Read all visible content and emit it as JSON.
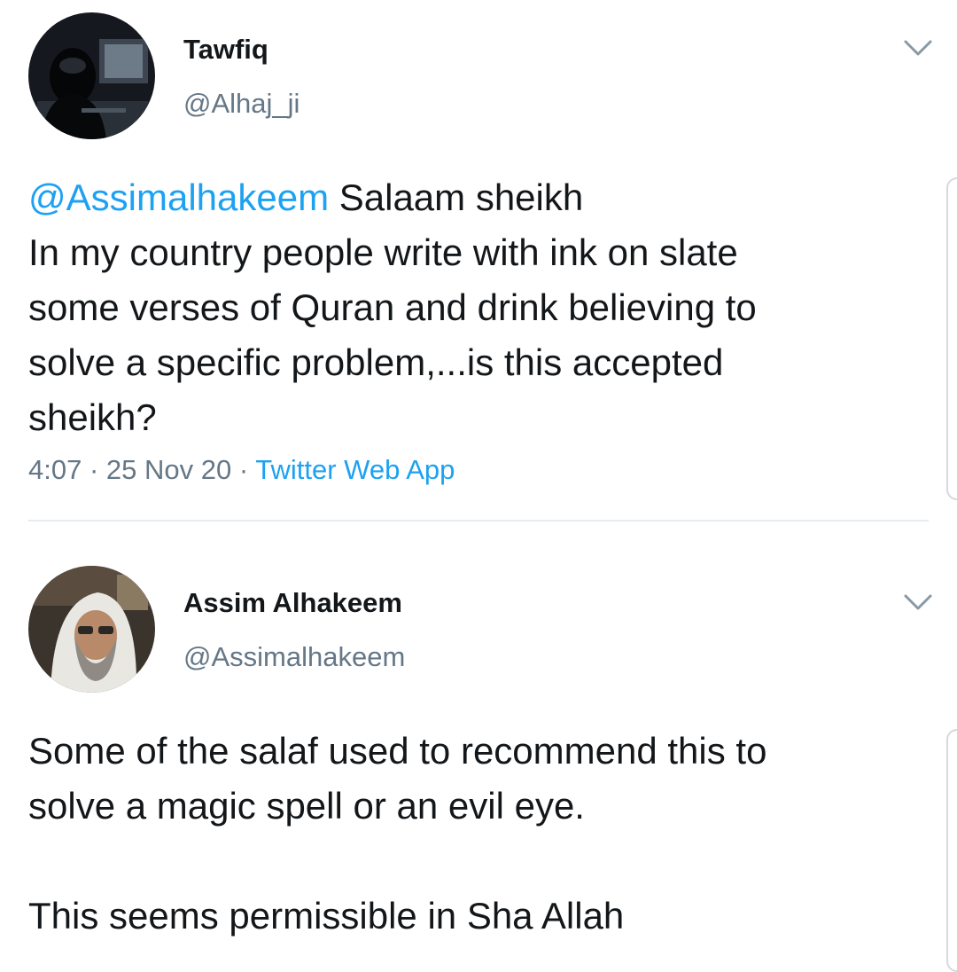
{
  "tweets": [
    {
      "author": {
        "name": "Tawfiq",
        "handle": "@Alhaj_ji",
        "avatar_icon": "hooded-hacker-avatar"
      },
      "text": {
        "mention": "@Assimalhakeem",
        "first_line_rest": " Salaam sheikh",
        "lines": [
          "In my country people write with ink on slate",
          "some verses of Quran and drink believing to",
          "solve a specific problem,...is this accepted",
          "sheikh?"
        ]
      },
      "meta": {
        "time": "4:07",
        "separator": " · ",
        "date": "25 Nov 20",
        "source": "Twitter Web App"
      },
      "menu_icon": "chevron-down-icon"
    },
    {
      "author": {
        "name": "Assim Alhakeem",
        "handle": "@Assimalhakeem",
        "avatar_icon": "sheikh-portrait-avatar"
      },
      "text": {
        "lines": [
          "Some of the salaf used to recommend this to",
          "solve a magic spell or an evil eye.",
          "",
          "This seems permissible in Sha Allah"
        ]
      },
      "menu_icon": "chevron-down-icon"
    }
  ],
  "colors": {
    "link": "#1da1f2",
    "primary_text": "#14171a",
    "secondary_text": "#657786",
    "divider": "#e6ecf0"
  }
}
